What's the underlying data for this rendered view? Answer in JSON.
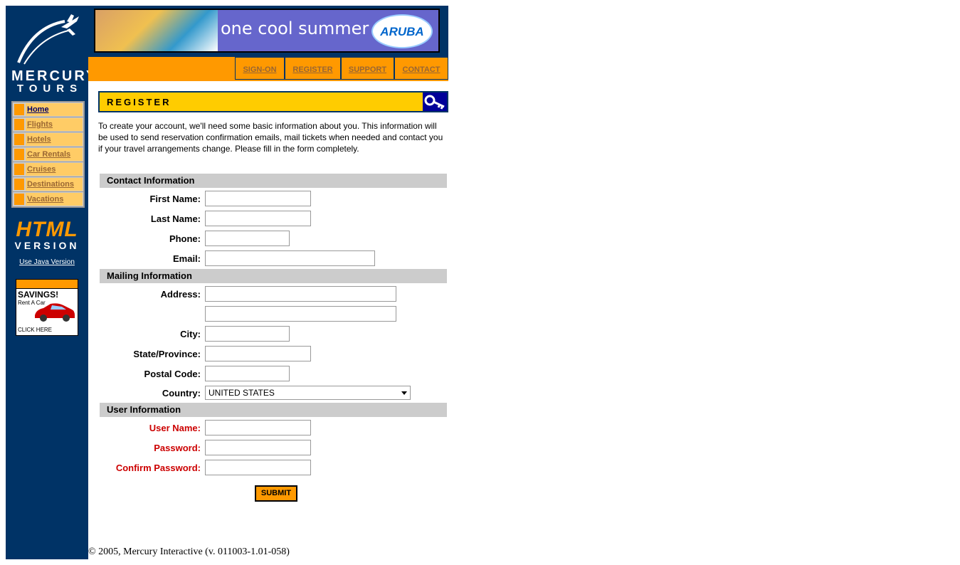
{
  "brand": {
    "name_line1": "MERCURY",
    "name_line2": "TOURS"
  },
  "sidebar": {
    "items": [
      {
        "label": "Home",
        "active": true
      },
      {
        "label": "Flights"
      },
      {
        "label": "Hotels"
      },
      {
        "label": "Car Rentals"
      },
      {
        "label": "Cruises"
      },
      {
        "label": "Destinations"
      },
      {
        "label": "Vacations"
      }
    ],
    "html_big": "HTML",
    "html_small": "VERSION",
    "java_link": "Use Java Version",
    "ad": {
      "title": "SAVINGS!",
      "subtitle": "Rent A Car",
      "cta": "CLICK HERE"
    }
  },
  "banner": {
    "text": "one cool summer",
    "logo": "ARUBA"
  },
  "topnav": {
    "items": [
      "SIGN-ON",
      "REGISTER",
      "SUPPORT",
      "CONTACT"
    ]
  },
  "page": {
    "title": "REGISTER",
    "intro": "To create your account, we'll need some basic information about you. This information will be used to send reservation confirmation emails, mail tickets when needed and contact you if your travel arrangements change. Please fill in the form completely."
  },
  "form": {
    "contact_header": "Contact Information",
    "first_name": "First Name:",
    "last_name": "Last Name:",
    "phone": "Phone:",
    "email": "Email:",
    "mailing_header": "Mailing Information",
    "address": "Address:",
    "city": "City:",
    "state": "State/Province:",
    "postal": "Postal Code:",
    "country": "Country:",
    "country_value": "UNITED STATES",
    "user_header": "User Information",
    "user_name": "User Name:",
    "password": "Password:",
    "confirm_password": "Confirm Password:",
    "submit": "SUBMIT"
  },
  "footer": {
    "text": "© 2005, Mercury Interactive (v. 011003-1.01-058)"
  },
  "colors": {
    "navy": "#003366",
    "orange": "#ff9900",
    "yellow": "#ffcc00",
    "required_red": "#cc0000"
  }
}
